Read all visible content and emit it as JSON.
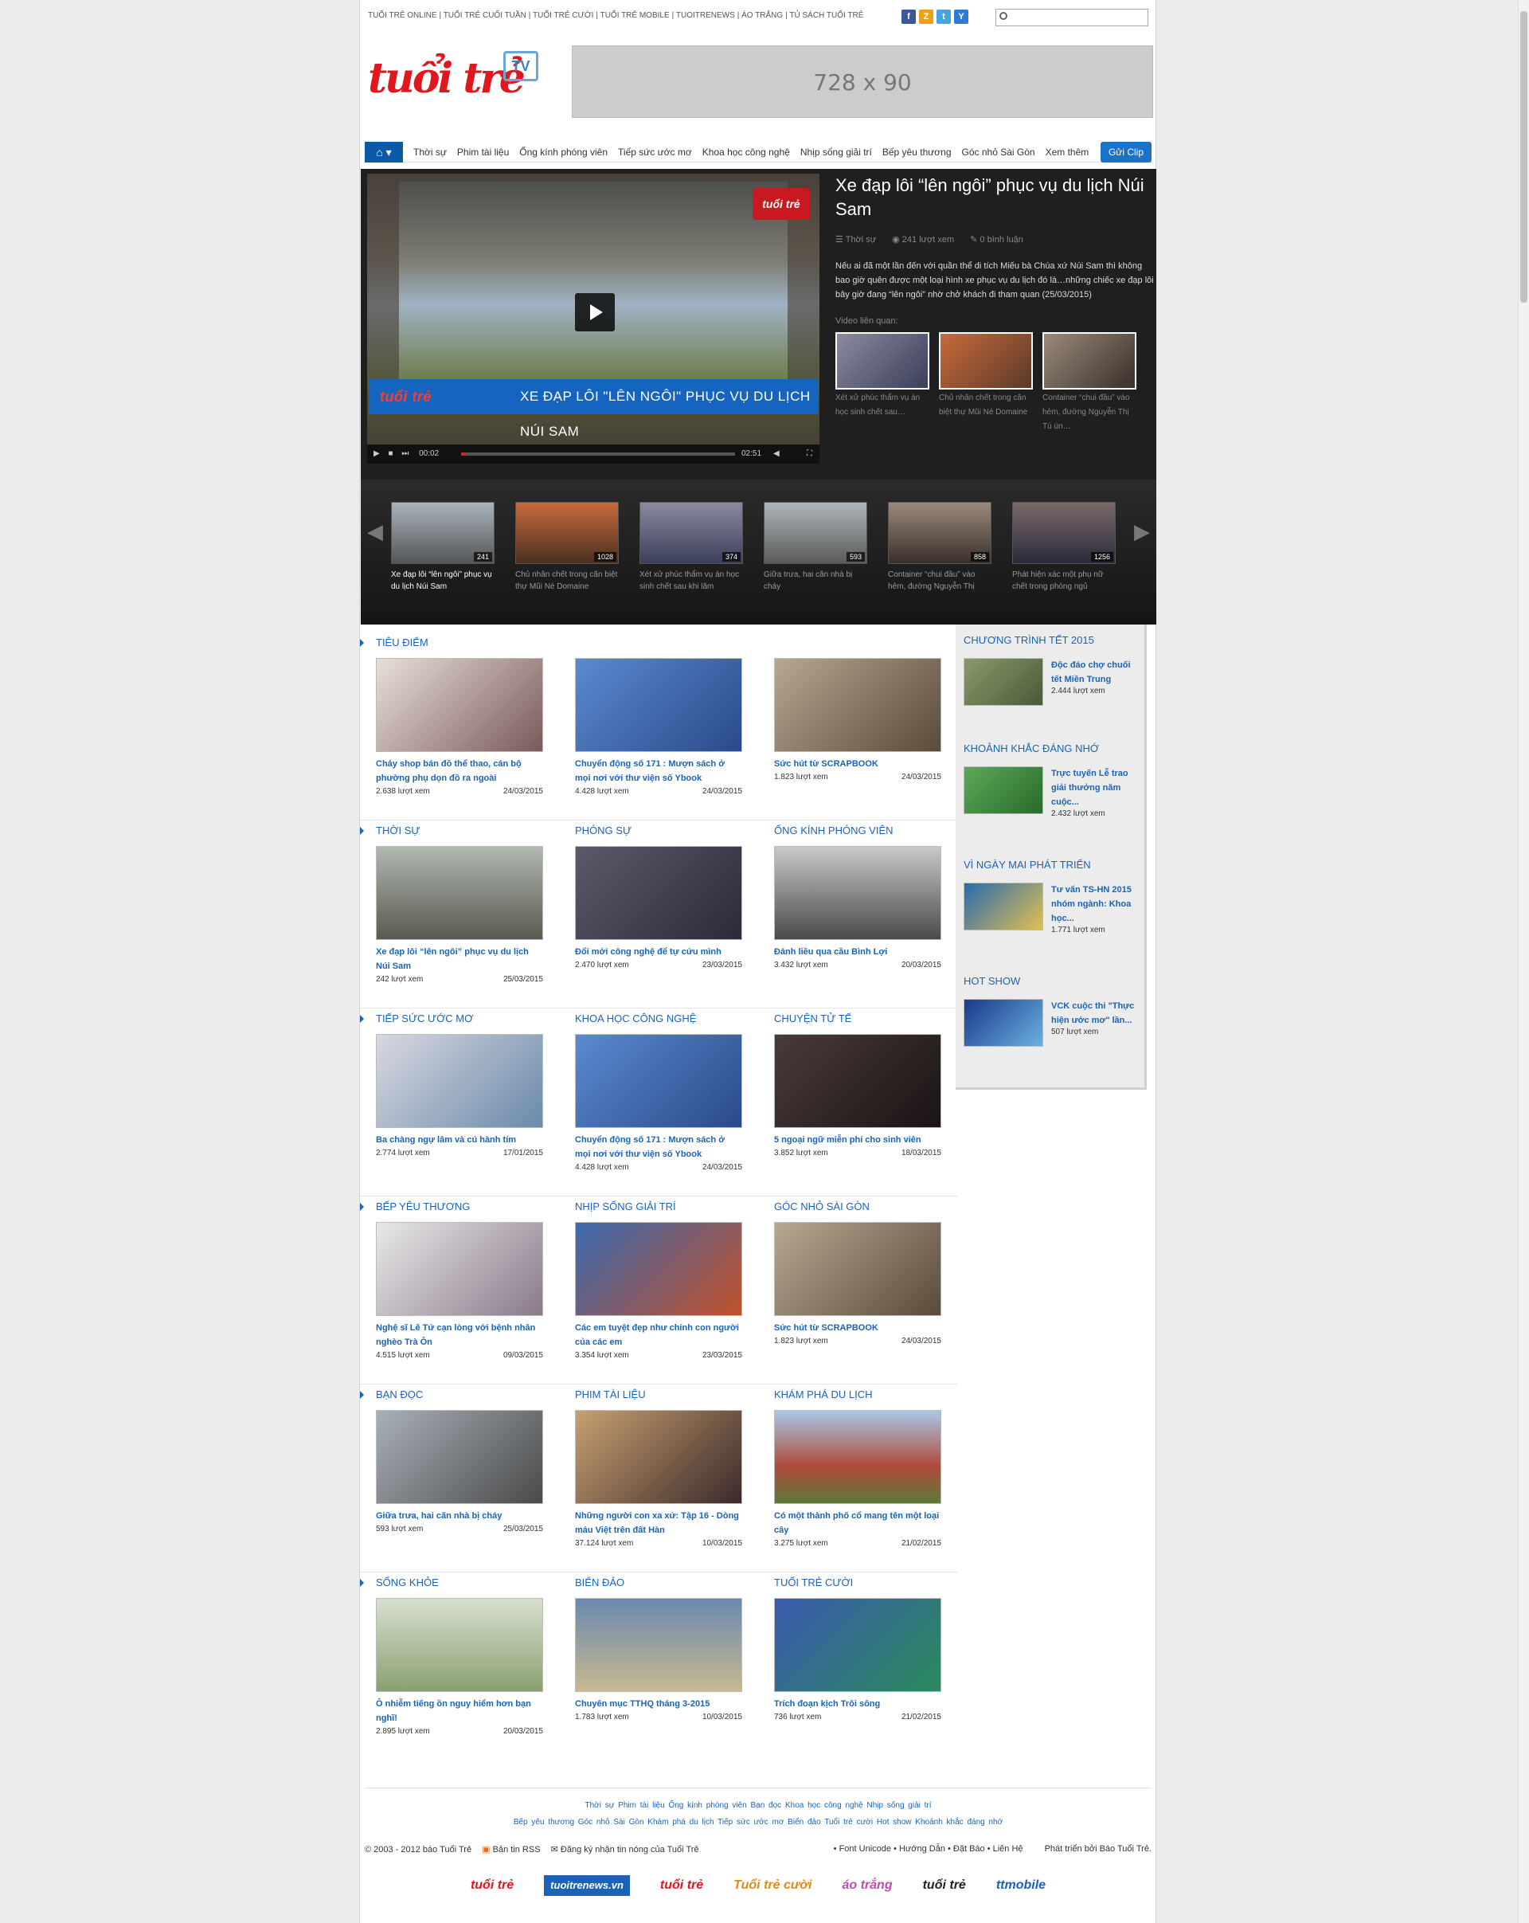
{
  "top_links": [
    "TUỔI TRẺ ONLINE",
    "TUỔI TRẺ CUỐI TUẦN",
    "TUỔI TRẺ CƯỜI",
    "TUỔI TRẺ MOBILE",
    "TUOITRENEWS",
    "ÁO TRẮNG",
    "TỦ SÁCH TUỔI TRẺ"
  ],
  "social": [
    "f",
    "Z",
    "t",
    "Y"
  ],
  "logo": {
    "text": "tuổi trẻ",
    "tv": "TV"
  },
  "ad_label": "728 x 90",
  "nav": {
    "items": [
      "Thời sự",
      "Phim tài liệu",
      "Ống kính phóng viên",
      "Tiếp sức ước mơ",
      "Khoa học công nghệ",
      "Nhịp sống giải trí",
      "Bếp yêu thương",
      "Góc nhỏ Sài Gòn",
      "Xem thêm"
    ],
    "send": "Gửi Clip"
  },
  "video": {
    "banner_brand": "tuổi trẻ",
    "banner": "XE ĐẠP LÔI \"LÊN NGÔI\" PHỤC VỤ DU LỊCH NÚI SAM",
    "watermark": "tuổi trẻ",
    "time_current": "00:02",
    "time_total": "02:51",
    "progress": 0.01,
    "title": "Xe đạp lôi “lên ngôi” phục vụ du lịch Núi Sam",
    "category": "Thời sự",
    "views": "241 lượt xem",
    "comments": "0 bình luận",
    "desc": "Nếu ai đã một lần đến với quần thể di tích Miếu bà Chúa xứ Núi Sam thì không bao giờ quên được một loại hình xe phục vụ du lịch đó là…những chiếc xe đạp lôi bây giờ đang “lên ngôi” nhờ chở khách đi tham quan (25/03/2015)",
    "related_label": "Video liên quan:",
    "related": [
      "Xét xử phúc thẩm vụ án học sinh chết sau…",
      "Chủ nhân chết trong căn biệt thự Mũi Né Domaine",
      "Container “chui đầu” vào hẻm, đường Nguyễn Thị Tú ùn…"
    ]
  },
  "strip": [
    {
      "title": "Xe đạp lôi “lên ngôi” phục vụ du lịch Núi Sam",
      "views": "241"
    },
    {
      "title": "Chủ nhân chết trong căn biệt thự Mũi Né Domaine",
      "views": "1028"
    },
    {
      "title": "Xét xử phúc thẩm vụ án học sinh chết sau khi lăm",
      "views": "374"
    },
    {
      "title": "Giữa trưa, hai căn nhà bị cháy",
      "views": "593"
    },
    {
      "title": "Container “chui đầu” vào hẻm, đường Nguyễn Thị",
      "views": "858"
    },
    {
      "title": "Phát hiện xác một phụ nữ chết trong phòng ngủ",
      "views": "1256"
    }
  ],
  "rows": [
    [
      {
        "h": "TIÊU ĐIỂM",
        "t": "Cháy shop bán đồ thể thao, cán bộ phường phụ dọn đồ ra ngoài",
        "v": "2.638 lượt xem",
        "d": "24/03/2015"
      },
      {
        "h": "",
        "t": "Chuyển động số 171 : Mượn sách ở mọi nơi với thư viện số Ybook",
        "v": "4.428 lượt xem",
        "d": "24/03/2015"
      },
      {
        "h": "",
        "t": "Sức hút từ SCRAPBOOK",
        "v": "1.823 lượt xem",
        "d": "24/03/2015"
      }
    ],
    [
      {
        "h": "THỜI SỰ",
        "t": "Xe đạp lôi “lên ngôi” phục vụ du lịch Núi Sam",
        "v": "242 lượt xem",
        "d": "25/03/2015"
      },
      {
        "h": "PHÓNG SỰ",
        "t": "Đổi mới công nghệ để tự cứu mình",
        "v": "2.470 lượt xem",
        "d": "23/03/2015"
      },
      {
        "h": "ỐNG KÍNH PHÓNG VIÊN",
        "t": "Đánh liều qua cầu Bình Lợi",
        "v": "3.432 lượt xem",
        "d": "20/03/2015"
      }
    ],
    [
      {
        "h": "TIẾP SỨC ƯỚC MƠ",
        "t": "Ba chàng ngự lâm và cú hành tím",
        "v": "2.774 lượt xem",
        "d": "17/01/2015"
      },
      {
        "h": "KHOA HỌC CÔNG NGHỆ",
        "t": "Chuyển động số 171 : Mượn sách ở mọi nơi với thư viện số Ybook",
        "v": "4.428 lượt xem",
        "d": "24/03/2015"
      },
      {
        "h": "CHUYỆN TỬ TẾ",
        "t": "5 ngoại ngữ miễn phí cho sinh viên",
        "v": "3.852 lượt xem",
        "d": "18/03/2015"
      }
    ],
    [
      {
        "h": "BẾP YÊU THƯƠNG",
        "t": "Nghệ sĩ Lê Tứ cạn lòng với bệnh nhân nghèo Trà Ôn",
        "v": "4.515 lượt xem",
        "d": "09/03/2015"
      },
      {
        "h": "NHỊP SỐNG GIẢI TRÍ",
        "t": "Các em tuyệt đẹp như chính con người của các em",
        "v": "3.354 lượt xem",
        "d": "23/03/2015"
      },
      {
        "h": "GÓC NHỎ SÀI GÒN",
        "t": "Sức hút từ SCRAPBOOK",
        "v": "1.823 lượt xem",
        "d": "24/03/2015"
      }
    ],
    [
      {
        "h": "BẠN ĐỌC",
        "t": "Giữa trưa, hai căn nhà bị cháy",
        "v": "593 lượt xem",
        "d": "25/03/2015"
      },
      {
        "h": "PHIM TÀI LIỆU",
        "t": "Những người con xa xứ: Tập 16 - Dòng máu Việt trên đất Hàn",
        "v": "37.124 lượt xem",
        "d": "10/03/2015"
      },
      {
        "h": "KHÁM PHÁ DU LỊCH",
        "t": "Có một thành phố cổ mang tên một loại cây",
        "v": "3.275 lượt xem",
        "d": "21/02/2015"
      }
    ],
    [
      {
        "h": "SỐNG KHỎE",
        "t": "Ô nhiễm tiếng ồn nguy hiểm hơn bạn nghĩ!",
        "v": "2.895 lượt xem",
        "d": "20/03/2015"
      },
      {
        "h": "BIỂN ĐẢO",
        "t": "Chuyên mục TTHQ tháng 3-2015",
        "v": "1.783 lượt xem",
        "d": "10/03/2015"
      },
      {
        "h": "TUỔI TRẺ CƯỜI",
        "t": "Trích đoạn kịch Trôi sông",
        "v": "736 lượt xem",
        "d": "21/02/2015"
      }
    ]
  ],
  "side": [
    {
      "h": "CHƯƠNG TRÌNH TẾT 2015",
      "t": "Độc đáo chợ chuối tết Miền Trung",
      "v": "2.444 lượt xem"
    },
    {
      "h": "KHOẢNH KHẮC ĐÁNG NHỚ",
      "t": "Trực tuyến Lễ trao giải thưởng năm cuộc...",
      "v": "2.432 lượt xem"
    },
    {
      "h": "VÌ NGÀY MAI PHÁT TRIỂN",
      "t": "Tư vấn TS-HN 2015 nhóm ngành: Khoa học...",
      "v": "1.771 lượt xem"
    },
    {
      "h": "HOT SHOW",
      "t": "VCK cuộc thi \"Thực hiện ước mơ\" lần...",
      "v": "507 lượt xem"
    }
  ],
  "footer": {
    "links1": "Thời sự   Phim tài liệu   Ống kính phóng viên   Bạn đọc   Khoa học công nghệ   Nhịp sống giải trí",
    "links2": "Bếp yêu thương   Góc nhỏ Sài Gòn   Khám phá du lịch   Tiếp sức ước mơ   Biển đảo   Tuổi trẻ cười   Hot show   Khoảnh khắc đáng nhớ",
    "copy": "© 2003 - 2012 báo Tuổi Trẻ",
    "rss": "Bản tin RSS",
    "mail": "Đăng ký nhận tin nóng của Tuổi Trẻ",
    "tools": "• Font Unicode • Hướng Dẫn • Đặt Báo • Liên Hệ",
    "dev": "Phát triển bởi Báo Tuổi Trẻ.",
    "logos": [
      "tuổi trẻ",
      "tuoitrenews.vn",
      "tuổi trẻ",
      "Tuổi trẻ cười",
      "áo trắng",
      "tuổi trẻ",
      "ttmobile"
    ]
  }
}
